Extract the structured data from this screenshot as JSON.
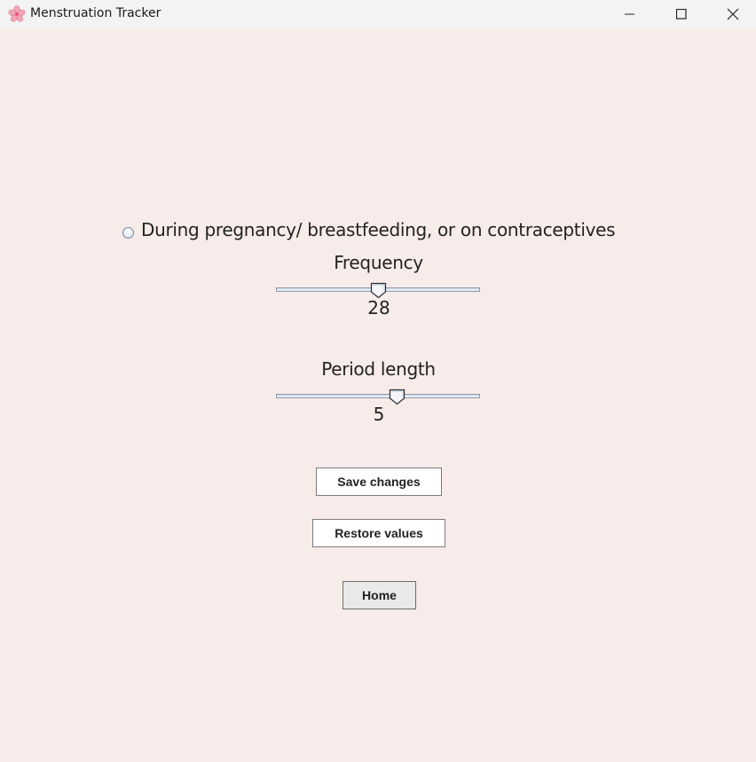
{
  "window": {
    "title": "Menstruation Tracker",
    "icon": "cherry-blossom-icon",
    "controls": {
      "minimize": "minimize-icon",
      "maximize": "maximize-icon",
      "close": "close-icon"
    }
  },
  "form": {
    "pregnancy_option": {
      "label": "During pregnancy/ breastfeeding, or on contraceptives",
      "checked": false
    },
    "frequency": {
      "label": "Frequency",
      "value": "28",
      "position_fraction": 0.5
    },
    "period_length": {
      "label": "Period length",
      "value": "5",
      "position_fraction": 0.6
    }
  },
  "buttons": {
    "save": "Save changes",
    "restore": "Restore values",
    "home": "Home"
  },
  "colors": {
    "background": "#f7ecea",
    "titlebar": "#f3f3f3",
    "accent_blossom": "#f4a6b8"
  }
}
